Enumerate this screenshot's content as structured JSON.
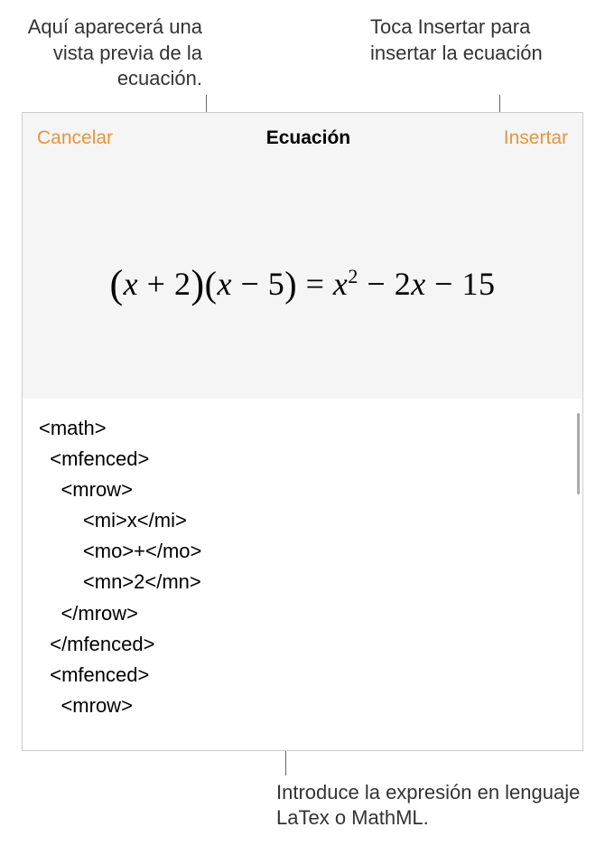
{
  "callouts": {
    "top_left": "Aquí aparecerá una vista previa de la ecuación.",
    "top_right": "Toca Insertar para insertar la ecuación",
    "bottom": "Introduce la expresión en lenguaje LaTex o MathML."
  },
  "header": {
    "cancel_label": "Cancelar",
    "title": "Ecuación",
    "insert_label": "Insertar"
  },
  "equation": {
    "lp1": "(",
    "x1": "x",
    "plus": " + ",
    "two": "2",
    "rp1": ")",
    "lp2": "(",
    "x2": "x",
    "minus1": " − ",
    "five": "5",
    "rp2": ")",
    "eq": " = ",
    "x3": "x",
    "sq": "2",
    "minus2": " − ",
    "twox": "2",
    "x4": "x",
    "minus3": " − ",
    "fifteen": "15"
  },
  "input_code": "<math>\n  <mfenced>\n    <mrow>\n        <mi>x</mi>\n        <mo>+</mo>\n        <mn>2</mn>\n    </mrow>\n  </mfenced>\n  <mfenced>\n    <mrow>"
}
